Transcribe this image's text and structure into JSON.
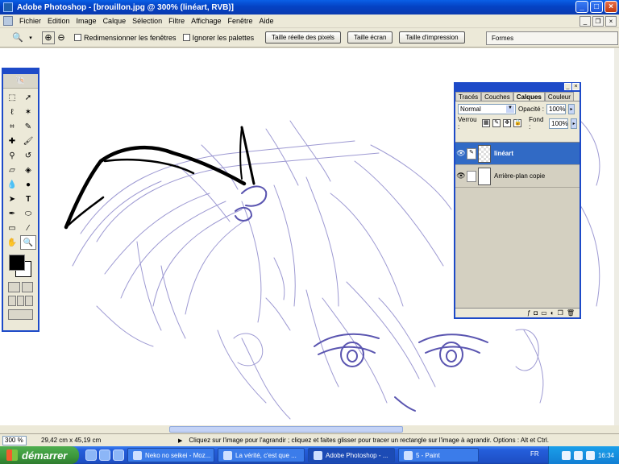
{
  "window": {
    "title": "Adobe Photoshop - [brouillon.jpg @ 300% (linéart, RVB)]",
    "buttons": {
      "minimize": "_",
      "maximize": "□",
      "close": "×"
    }
  },
  "menubar": {
    "items": [
      "Fichier",
      "Edition",
      "Image",
      "Calque",
      "Sélection",
      "Filtre",
      "Affichage",
      "Fenêtre",
      "Aide"
    ]
  },
  "options": {
    "check_resize": "Redimensionner les fenêtres",
    "check_ignore": "Ignorer les palettes",
    "btn_actual": "Taille réelle des pixels",
    "btn_screen": "Taille écran",
    "btn_print": "Taille d'impression",
    "palette_well": "Formes"
  },
  "layers_panel": {
    "tabs": [
      "Tracés",
      "Couches",
      "Calques",
      "Couleur"
    ],
    "active_tab": "Calques",
    "blend_mode": "Normal",
    "opacity_label": "Opacité :",
    "opacity_value": "100%",
    "lock_label": "Verrou :",
    "fill_label": "Fond :",
    "fill_value": "100%",
    "layers": [
      {
        "name": "linéart",
        "selected": true
      },
      {
        "name": "Arrière-plan copie",
        "selected": false
      }
    ]
  },
  "status": {
    "zoom": "300 %",
    "doc_size": "29,42 cm x 45,19 cm",
    "hint": "Cliquez sur l'image pour l'agrandir ; cliquez et faites glisser pour tracer un rectangle sur l'image à agrandir. Options : Alt et Ctrl."
  },
  "taskbar": {
    "start_label": "démarrer",
    "tasks": [
      {
        "label": "Neko no seikei - Moz...",
        "active": false
      },
      {
        "label": "La vérité, c'est que ...",
        "active": false
      },
      {
        "label": "Adobe Photoshop - ...",
        "active": true
      },
      {
        "label": "5 - Paint",
        "active": false
      }
    ],
    "lang": "FR",
    "clock": "16:34"
  },
  "colors": {
    "sketch_stroke": "#5a55b0",
    "lineart_stroke": "#000000",
    "selection_blue": "#316ac5",
    "title_blue": "#0a5fe6"
  }
}
